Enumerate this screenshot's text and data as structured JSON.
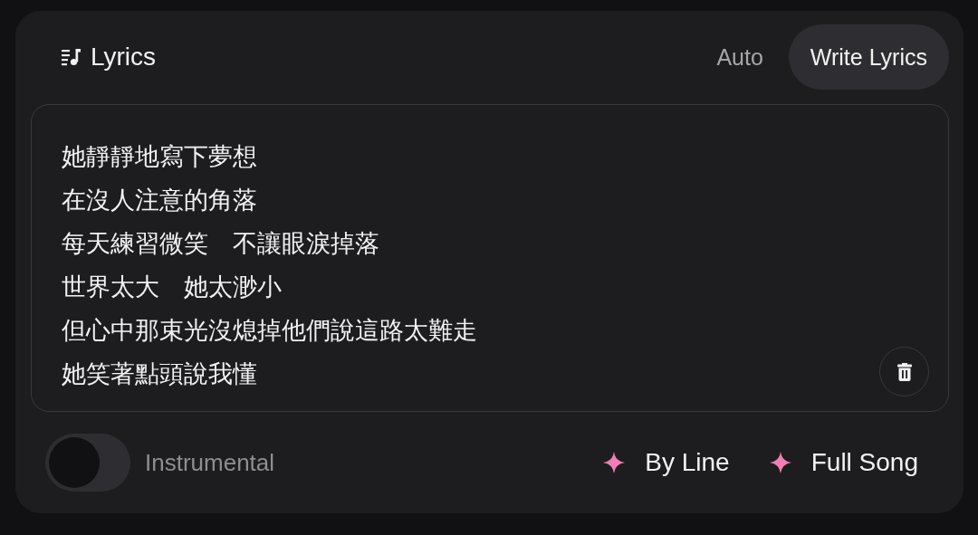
{
  "header": {
    "title": "Lyrics"
  },
  "tabs": [
    {
      "label": "Auto",
      "selected": false
    },
    {
      "label": "Write Lyrics",
      "selected": true
    }
  ],
  "lyrics": [
    "她靜靜地寫下夢想",
    "在沒人注意的角落",
    "每天練習微笑　不讓眼淚掉落",
    "世界太大　她太渺小",
    "但心中那束光沒熄掉他們說這路太難走",
    "她笑著點頭說我懂"
  ],
  "instrumental": {
    "label": "Instrumental",
    "on": false
  },
  "actions": [
    {
      "label": "By Line"
    },
    {
      "label": "Full Song"
    }
  ]
}
